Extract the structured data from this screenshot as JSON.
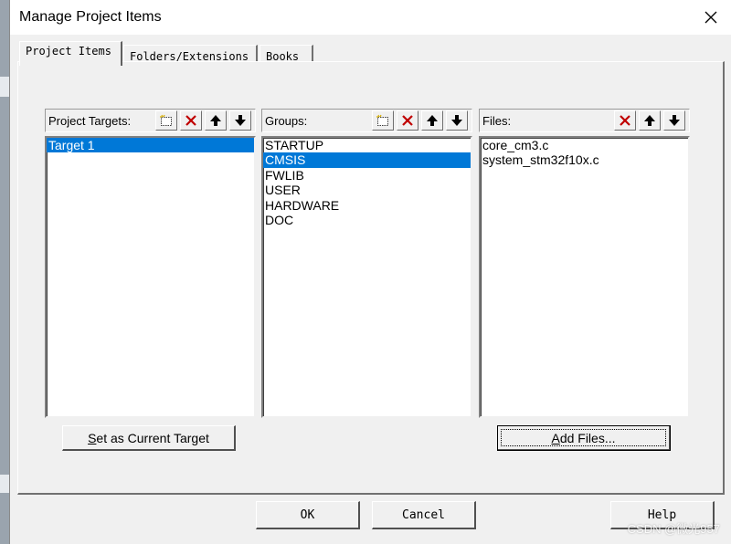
{
  "window": {
    "title": "Manage Project Items",
    "close_glyph": "✕"
  },
  "tabs": [
    {
      "label": "Project Items",
      "active": true
    },
    {
      "label": "Folders/Extensions",
      "active": false
    },
    {
      "label": "Books",
      "active": false
    }
  ],
  "targets": {
    "header": "Project Targets:",
    "items": [
      "Target 1"
    ],
    "selected_index": 0
  },
  "groups": {
    "header": "Groups:",
    "items": [
      "STARTUP",
      "CMSIS",
      "FWLIB",
      "USER",
      "HARDWARE",
      "DOC"
    ],
    "selected_index": 1
  },
  "files": {
    "header": "Files:",
    "items": [
      "core_cm3.c",
      "system_stm32f10x.c"
    ]
  },
  "buttons": {
    "set_current": {
      "mnemonic": "S",
      "rest": "et as Current Target"
    },
    "add_files": {
      "mnemonic": "A",
      "rest": "dd Files..."
    },
    "ok": "OK",
    "cancel": "Cancel",
    "help": "Help"
  },
  "watermark": "CSDN @微光957",
  "icons": [
    "new-item-icon",
    "delete-icon",
    "move-up-icon",
    "move-down-icon",
    "close-icon"
  ],
  "colors": {
    "selection": "#0078d7",
    "delete": "#c00000",
    "face": "#f0f0f0"
  }
}
